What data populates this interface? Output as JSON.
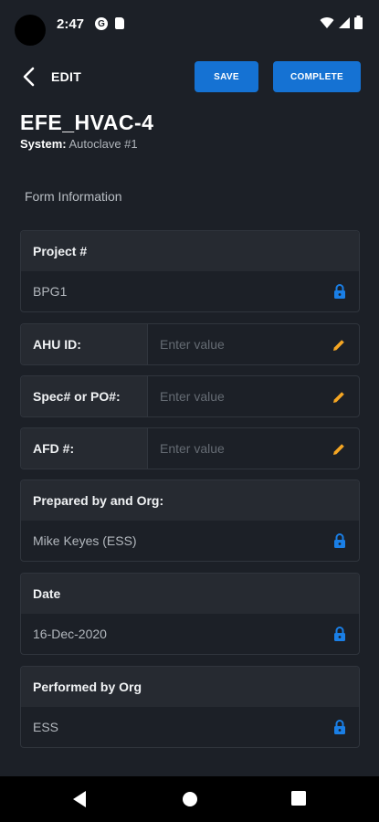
{
  "status_bar": {
    "time": "2:47",
    "icons": [
      "google-icon",
      "sd-card-icon",
      "wifi-icon",
      "signal-icon",
      "battery-icon"
    ]
  },
  "header": {
    "title": "EDIT",
    "save_label": "SAVE",
    "complete_label": "COMPLETE",
    "accent_color": "#1572d3"
  },
  "page": {
    "title": "EFE_HVAC-4",
    "system_label": "System:",
    "system_value": "Autoclave #1",
    "section_label": "Form Information"
  },
  "fields": {
    "project": {
      "label": "Project #",
      "value": "BPG1",
      "icon": "lock-icon"
    },
    "ahu_id": {
      "label": "AHU ID:",
      "placeholder": "Enter value",
      "icon": "pencil-icon"
    },
    "spec_po": {
      "label": "Spec# or PO#:",
      "placeholder": "Enter value",
      "icon": "pencil-icon"
    },
    "afd": {
      "label": "AFD #:",
      "placeholder": "Enter value",
      "icon": "pencil-icon"
    },
    "prepared_by": {
      "label": "Prepared by and Org:",
      "value": "Mike Keyes (ESS)",
      "icon": "lock-icon"
    },
    "date": {
      "label": "Date",
      "value": "16-Dec-2020",
      "icon": "lock-icon"
    },
    "performed_by": {
      "label": "Performed by Org",
      "value": "ESS",
      "icon": "lock-icon"
    }
  },
  "colors": {
    "lock": "#1a7fe6",
    "pencil": "#f5a623"
  },
  "nav": {
    "icons": [
      "back-triangle-icon",
      "home-circle-icon",
      "recents-square-icon"
    ]
  }
}
